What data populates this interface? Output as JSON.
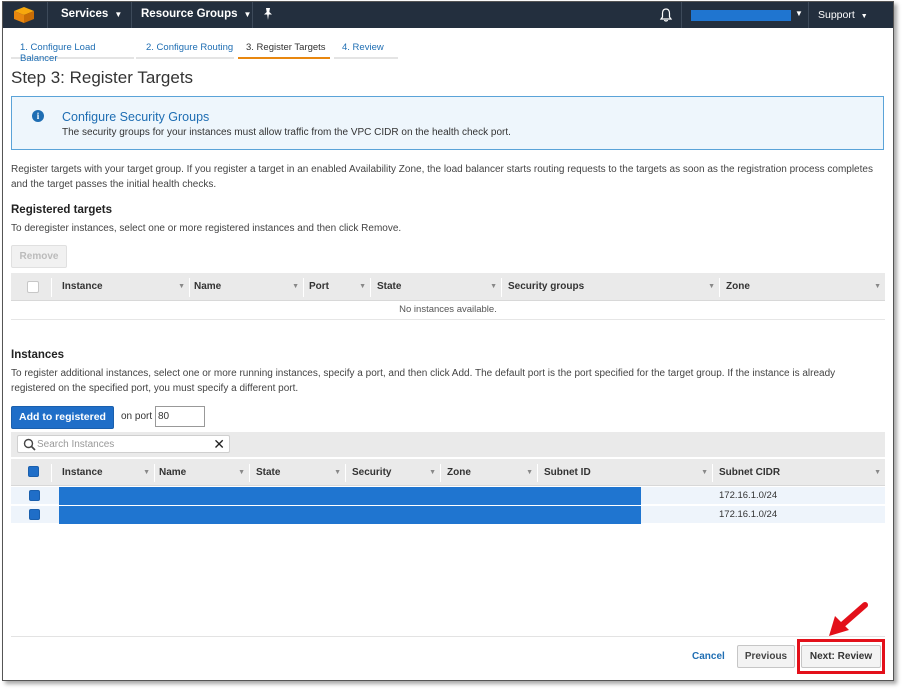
{
  "topnav": {
    "services_label": "Services",
    "resource_groups_label": "Resource Groups",
    "support_label": "Support"
  },
  "wizard": {
    "steps": [
      {
        "label": "1. Configure Load Balancer"
      },
      {
        "label": "2. Configure Routing"
      },
      {
        "label": "3. Register Targets"
      },
      {
        "label": "4. Review"
      }
    ]
  },
  "page": {
    "title": "Step 3: Register Targets"
  },
  "info_box": {
    "title": "Configure Security Groups",
    "text": "The security groups for your instances must allow traffic from the VPC CIDR on the health check port."
  },
  "intro": "Register targets with your target group. If you register a target in an enabled Availability Zone, the load balancer starts routing requests to the targets as soon as the registration process completes and the target passes the initial health checks.",
  "registered": {
    "title": "Registered targets",
    "subtitle": "To deregister instances, select one or more registered instances and then click Remove.",
    "remove_label": "Remove",
    "columns": [
      "Instance",
      "Name",
      "Port",
      "State",
      "Security groups",
      "Zone"
    ],
    "empty_text": "No instances available."
  },
  "instances": {
    "title": "Instances",
    "subtitle": "To register additional instances, select one or more running instances, specify a port, and then click Add. The default port is the port specified for the target group. If the instance is already registered on the specified port, you must specify a different port.",
    "add_label": "Add to registered",
    "on_port_label": "on port",
    "port_value": "80",
    "search_placeholder": "Search Instances",
    "columns": [
      "Instance",
      "Name",
      "State",
      "Security",
      "Zone",
      "Subnet ID",
      "Subnet CIDR"
    ],
    "rows": [
      {
        "subnet_cidr": "172.16.1.0/24"
      },
      {
        "subnet_cidr": "172.16.1.0/24"
      }
    ]
  },
  "footer": {
    "cancel_label": "Cancel",
    "previous_label": "Previous",
    "next_label": "Next: Review"
  },
  "colors": {
    "nav_bg": "#232f3e",
    "primary_blue": "#1f6ec8",
    "active_tab": "#e8870f",
    "highlight_red": "#e3101a"
  }
}
